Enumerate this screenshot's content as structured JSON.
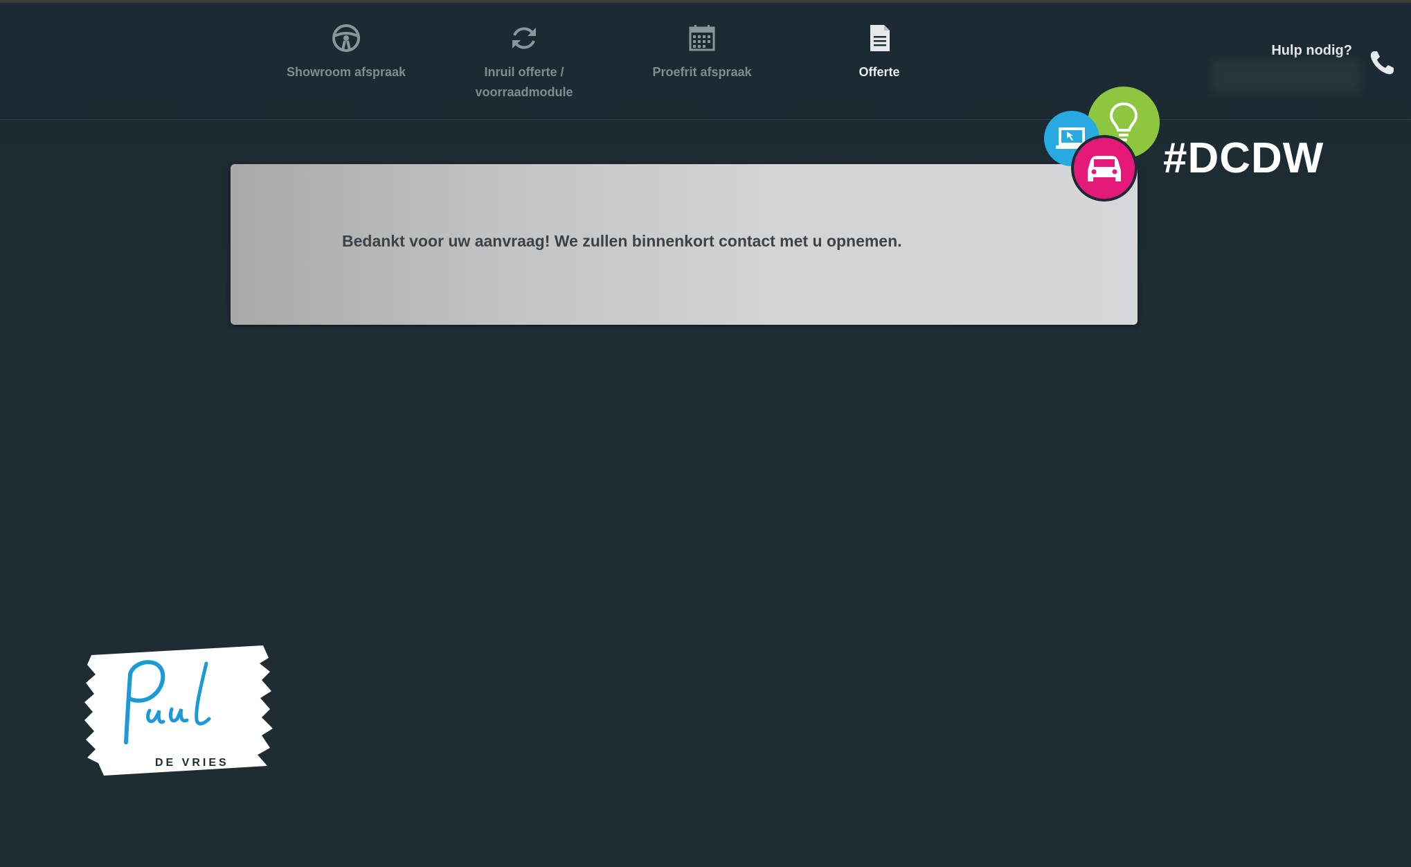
{
  "nav": {
    "items": [
      {
        "label_line1": "Showroom afspraak",
        "label_line2": "",
        "icon": "steering-wheel-icon"
      },
      {
        "label_line1": "Inruil offerte /",
        "label_line2": "voorraadmodule",
        "icon": "refresh-icon"
      },
      {
        "label_line1": "Proefrit afspraak",
        "label_line2": "",
        "icon": "calendar-icon"
      },
      {
        "label_line1": "Offerte",
        "label_line2": "",
        "icon": "document-icon"
      }
    ],
    "active_index": 3
  },
  "help": {
    "label": "Hulp nodig?",
    "icon": "phone-icon"
  },
  "message": {
    "text": "Bedankt voor uw aanvraag! We zullen binnenkort contact met u opnemen."
  },
  "branding": {
    "hashtag": "#DCDW",
    "logo_icons": [
      "laptop-icon",
      "lightbulb-icon",
      "car-icon"
    ],
    "logo_colors": {
      "blue": "#29a9e1",
      "green": "#8dc63f",
      "pink": "#e5197a"
    },
    "signature_logo": {
      "script": "Paul",
      "subtitle": "DE VRIES",
      "color": "#1b9ad6"
    }
  }
}
